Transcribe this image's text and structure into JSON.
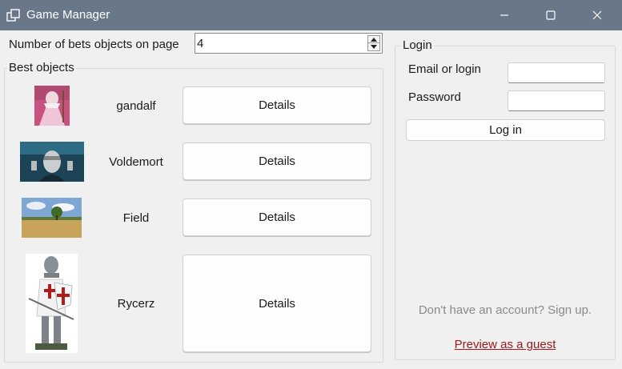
{
  "window": {
    "title": "Game Manager"
  },
  "page_size": {
    "label": "Number of bets objects on page",
    "value": "4"
  },
  "best_objects": {
    "title": "Best objects",
    "items": [
      {
        "name": "gandalf",
        "button": "Details",
        "image": "gandalf-image"
      },
      {
        "name": "Voldemort",
        "button": "Details",
        "image": "voldemort-image"
      },
      {
        "name": "Field",
        "button": "Details",
        "image": "field-image"
      },
      {
        "name": "Rycerz",
        "button": "Details",
        "image": "knight-image"
      }
    ]
  },
  "login": {
    "title": "Login",
    "email_label": "Email or login",
    "password_label": "Password",
    "button": "Log in",
    "signup_text": "Don't have an account? Sign up.",
    "guest_link": "Preview as a guest"
  },
  "colors": {
    "titlebar": "#687889",
    "background": "#f0f0f0",
    "link": "#a01818",
    "muted": "#8a8a8a"
  }
}
